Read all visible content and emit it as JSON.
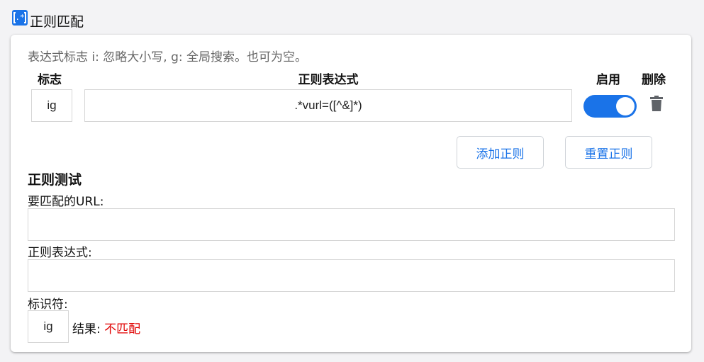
{
  "section": {
    "title": "正则匹配",
    "icon": "regex-icon"
  },
  "card": {
    "hint": "表达式标志 i: 忽略大小写, g: 全局搜索。也可为空。",
    "columns": {
      "flags": "标志",
      "regex": "正则表达式",
      "enable": "启用",
      "delete": "删除"
    },
    "rows": [
      {
        "flags": "ig",
        "regex": ".*vurl=([^&]*)",
        "enabled": true
      }
    ],
    "buttons": {
      "add": "添加正则",
      "reset": "重置正则"
    }
  },
  "test": {
    "title": "正则测试",
    "url_label": "要匹配的URL:",
    "url_value": "",
    "regex_label": "正则表达式:",
    "regex_value": "",
    "flags_label": "标识符:",
    "flags_value": "ig",
    "result_label": "结果: ",
    "result_value": "不匹配"
  },
  "colors": {
    "accent": "#1a73e8",
    "no_match": "#e00000",
    "delete_icon": "#5f6368"
  }
}
